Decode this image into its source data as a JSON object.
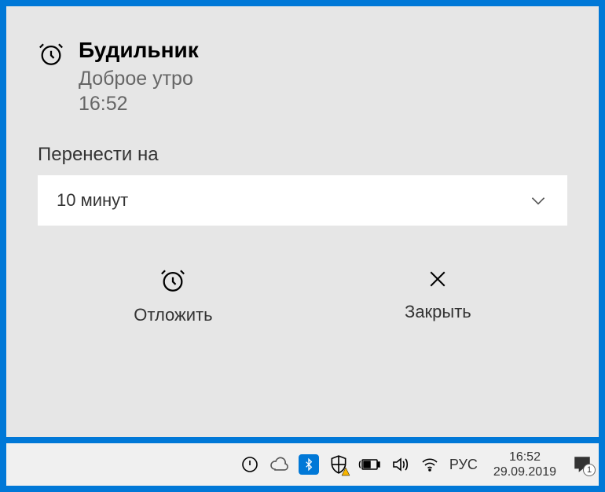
{
  "notification": {
    "title": "Будильник",
    "subtitle": "Доброе утро",
    "time": "16:52",
    "snooze_label": "Перенести на",
    "dropdown_value": "10 минут",
    "snooze_action": "Отложить",
    "close_action": "Закрыть"
  },
  "taskbar": {
    "lang": "РУС",
    "clock_time": "16:52",
    "clock_date": "29.09.2019",
    "badge_count": "1"
  }
}
